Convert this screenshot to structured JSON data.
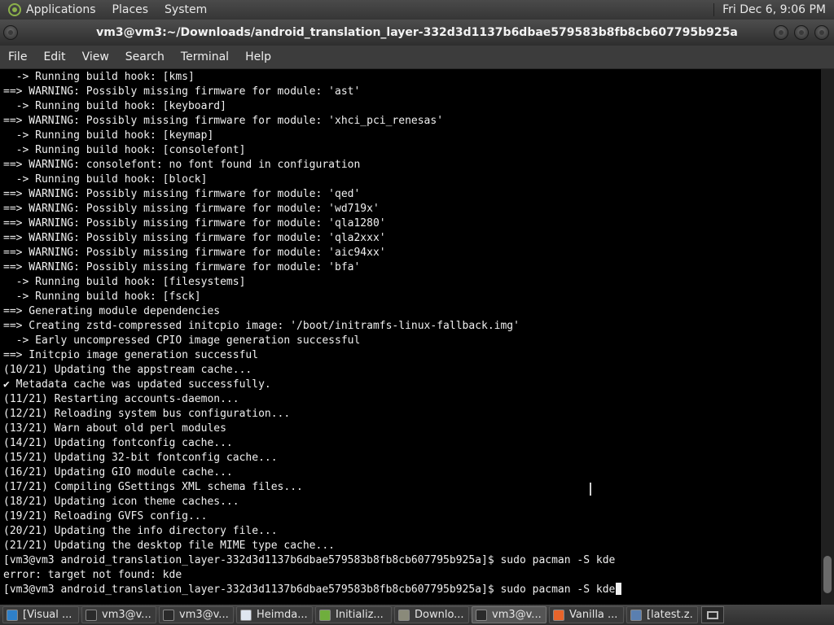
{
  "top_panel": {
    "menus": [
      "Applications",
      "Places",
      "System"
    ],
    "clock": "Fri Dec 6,  9:06 PM"
  },
  "window": {
    "title": "vm3@vm3:~/Downloads/android_translation_layer-332d3d1137b6dbae579583b8fb8cb607795b925a"
  },
  "menubar": [
    "File",
    "Edit",
    "View",
    "Search",
    "Terminal",
    "Help"
  ],
  "terminal": {
    "lines": [
      "  -> Running build hook: [kms]",
      "==> WARNING: Possibly missing firmware for module: 'ast'",
      "  -> Running build hook: [keyboard]",
      "==> WARNING: Possibly missing firmware for module: 'xhci_pci_renesas'",
      "  -> Running build hook: [keymap]",
      "  -> Running build hook: [consolefont]",
      "==> WARNING: consolefont: no font found in configuration",
      "  -> Running build hook: [block]",
      "==> WARNING: Possibly missing firmware for module: 'qed'",
      "==> WARNING: Possibly missing firmware for module: 'wd719x'",
      "==> WARNING: Possibly missing firmware for module: 'qla1280'",
      "==> WARNING: Possibly missing firmware for module: 'qla2xxx'",
      "==> WARNING: Possibly missing firmware for module: 'aic94xx'",
      "==> WARNING: Possibly missing firmware for module: 'bfa'",
      "  -> Running build hook: [filesystems]",
      "  -> Running build hook: [fsck]",
      "==> Generating module dependencies",
      "==> Creating zstd-compressed initcpio image: '/boot/initramfs-linux-fallback.img'",
      "  -> Early uncompressed CPIO image generation successful",
      "==> Initcpio image generation successful",
      "(10/21) Updating the appstream cache...",
      "✔ Metadata cache was updated successfully.",
      "(11/21) Restarting accounts-daemon...",
      "(12/21) Reloading system bus configuration...",
      "(13/21) Warn about old perl modules",
      "(14/21) Updating fontconfig cache...",
      "(15/21) Updating 32-bit fontconfig cache...",
      "(16/21) Updating GIO module cache...",
      "(17/21) Compiling GSettings XML schema files...",
      "(18/21) Updating icon theme caches...",
      "(19/21) Reloading GVFS config...",
      "(20/21) Updating the info directory file...",
      "(21/21) Updating the desktop file MIME type cache...",
      "[vm3@vm3 android_translation_layer-332d3d1137b6dbae579583b8fb8cb607795b925a]$ sudo pacman -S kde",
      "error: target not found: kde",
      "[vm3@vm3 android_translation_layer-332d3d1137b6dbae579583b8fb8cb607795b925a]$ sudo pacman -S kde"
    ]
  },
  "taskbar": {
    "items": [
      {
        "label": "[Visual ...",
        "icon": "vscode-icon",
        "color": "#2f80c9"
      },
      {
        "label": "vm3@v...",
        "icon": "terminal-icon",
        "color": "#2a2a2a"
      },
      {
        "label": "vm3@v...",
        "icon": "terminal-icon",
        "color": "#2a2a2a"
      },
      {
        "label": "Heimda...",
        "icon": "window-icon",
        "color": "#dfe6f0"
      },
      {
        "label": "Initializ...",
        "icon": "app-icon",
        "color": "#6fae3d"
      },
      {
        "label": "Downlo...",
        "icon": "folder-icon",
        "color": "#8a8a7a"
      },
      {
        "label": "vm3@v...",
        "icon": "terminal-icon",
        "color": "#2a2a2a",
        "active": true
      },
      {
        "label": "Vanilla ...",
        "icon": "firefox-icon",
        "color": "#e8642a"
      },
      {
        "label": "[latest.z...",
        "icon": "file-manager-icon",
        "color": "#5a7fb0"
      }
    ]
  }
}
